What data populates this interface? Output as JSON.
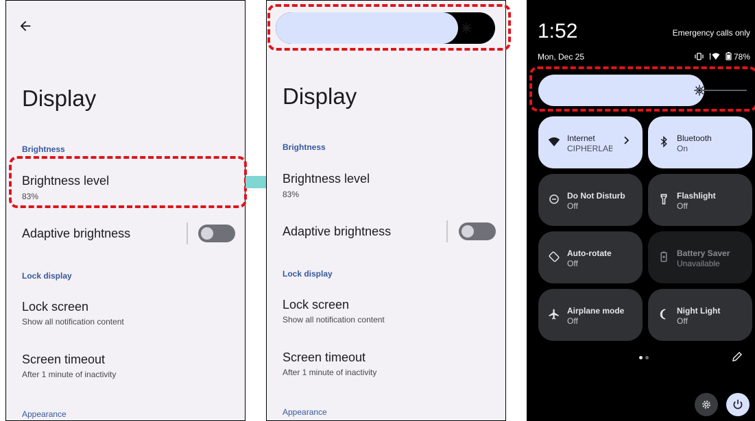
{
  "screen_left": {
    "title": "Display",
    "section_brightness": "Brightness",
    "brightness_level_title": "Brightness level",
    "brightness_level_value": "83%",
    "adaptive_brightness": "Adaptive brightness",
    "adaptive_brightness_on": false,
    "section_lock": "Lock display",
    "lock_screen_title": "Lock screen",
    "lock_screen_sub": "Show all notification content",
    "screen_timeout_title": "Screen timeout",
    "screen_timeout_sub": "After 1 minute of inactivity",
    "section_appearance": "Appearance"
  },
  "screen_middle": {
    "brightness_slider_level": 0.83,
    "title": "Display",
    "section_brightness": "Brightness",
    "brightness_level_title": "Brightness level",
    "brightness_level_value": "83%",
    "adaptive_brightness": "Adaptive brightness",
    "adaptive_brightness_on": false,
    "section_lock": "Lock display",
    "lock_screen_title": "Lock screen",
    "lock_screen_sub": "Show all notification content",
    "screen_timeout_title": "Screen timeout",
    "screen_timeout_sub": "After 1 minute of inactivity",
    "section_appearance": "Appearance"
  },
  "quick_settings": {
    "time": "1:52",
    "date": "Mon, Dec 25",
    "emergency": "Emergency calls only",
    "battery": "78%",
    "brightness_slider_level": 0.83,
    "tiles": [
      {
        "name": "Internet",
        "status": "CIPHERLAB",
        "icon": "wifi-icon",
        "state": "on"
      },
      {
        "name": "Bluetooth",
        "status": "On",
        "icon": "bluetooth-icon",
        "state": "on"
      },
      {
        "name": "Do Not Disturb",
        "status": "Off",
        "icon": "do-not-disturb-icon",
        "state": "off"
      },
      {
        "name": "Flashlight",
        "status": "Off",
        "icon": "flashlight-icon",
        "state": "off"
      },
      {
        "name": "Auto-rotate",
        "status": "Off",
        "icon": "auto-rotate-icon",
        "state": "off"
      },
      {
        "name": "Battery Saver",
        "status": "Unavailable",
        "icon": "battery-saver-icon",
        "state": "unavailable"
      },
      {
        "name": "Airplane mode",
        "status": "Off",
        "icon": "airplane-icon",
        "state": "off"
      },
      {
        "name": "Night Light",
        "status": "Off",
        "icon": "night-light-icon",
        "state": "off"
      }
    ],
    "page_indicator": {
      "current": 1,
      "total": 2
    }
  },
  "colors": {
    "highlight": "#e0141a",
    "arrow": "#7fd6d2",
    "tile_active": "#d9e2fd",
    "tile_inactive": "#303134"
  }
}
